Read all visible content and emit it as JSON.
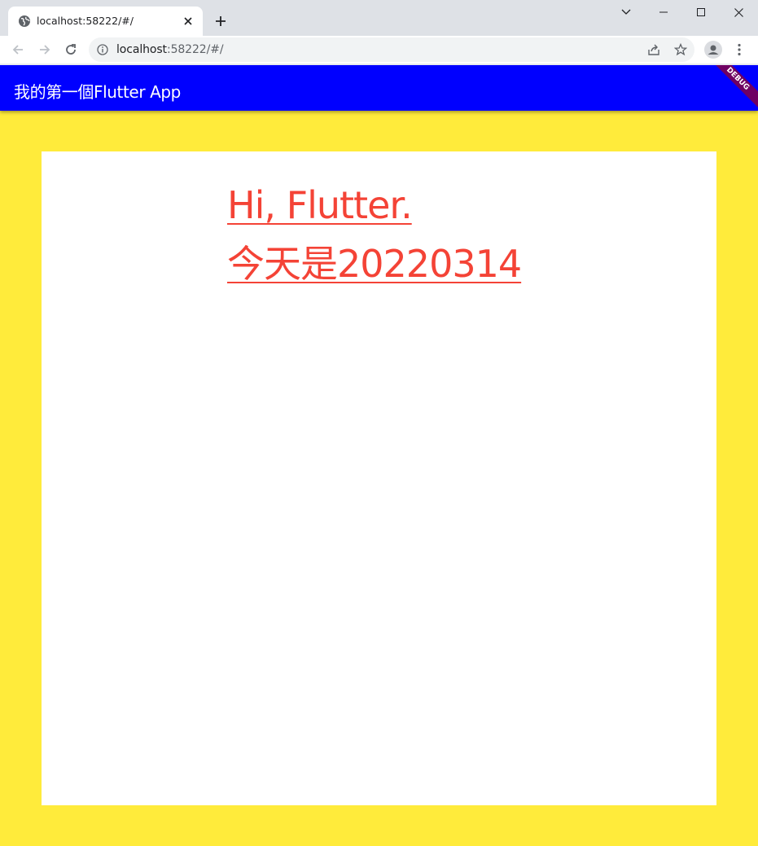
{
  "browser": {
    "tab_title": "localhost:58222/#/",
    "url_host": "localhost",
    "url_rest": ":58222/#/",
    "icons": [
      "globe-icon",
      "close-icon",
      "plus-icon",
      "chevron-down-icon",
      "minimize-icon",
      "maximize-icon",
      "window-close-icon",
      "back-arrow-icon",
      "forward-arrow-icon",
      "reload-icon",
      "info-icon",
      "share-icon",
      "star-icon",
      "profile-icon",
      "more-vert-icon"
    ]
  },
  "app": {
    "title": "我的第一個Flutter App",
    "debug_label": "DEBUG",
    "greeting_line1": "Hi, Flutter.",
    "greeting_line2": "今天是20220314",
    "colors": {
      "appbar": "#0000ff",
      "background": "#ffeb3b",
      "panel": "#ffffff",
      "text": "#f44336"
    }
  }
}
